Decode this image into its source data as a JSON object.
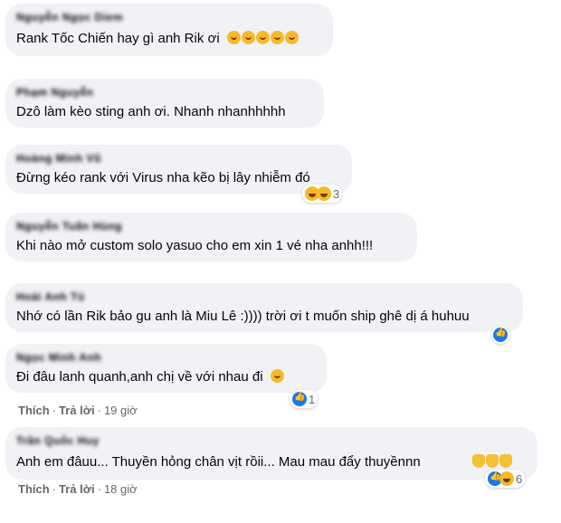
{
  "comments": [
    {
      "name": "Nguyễn Ngọc Diem",
      "text": "Rank Tốc Chiến hay gì anh Rik ơi"
    },
    {
      "name": "Phạm Nguyễn",
      "text": "Dzô làm kèo sting anh ơi. Nhanh nhanhhhhh"
    },
    {
      "name": "Hoàng Minh Vũ",
      "text": "Đừng kéo rank với Virus nha kẽo bị lây nhiễm đó",
      "reaction_count": "3"
    },
    {
      "name": "Nguyễn Tuấn Hùng",
      "text": "Khi nào mở custom solo yasuo cho em xin 1 vé nha anhh!!!"
    },
    {
      "name": "Hoài Anh Tú",
      "text": "Nhớ có lần Rik bảo gu anh là Miu Lê :)))) trời ơi t muốn ship ghê dị á huhuu"
    },
    {
      "name": "Ngọc Minh Anh",
      "text": "Đi đâu lanh quanh,anh chị về với nhau đi",
      "reaction_count": "1",
      "like_label": "Thích",
      "reply_label": "Trả lời",
      "time": "19 giờ"
    },
    {
      "name": "Trần Quốc Huy",
      "text": "Anh em đâuu... Thuyền hỏng chân vịt rồii... Mau mau đẩy thuyềnnn",
      "reaction_count": "6",
      "like_label": "Thích",
      "reply_label": "Trả lời",
      "time": "18 giờ"
    }
  ],
  "separator": "·"
}
